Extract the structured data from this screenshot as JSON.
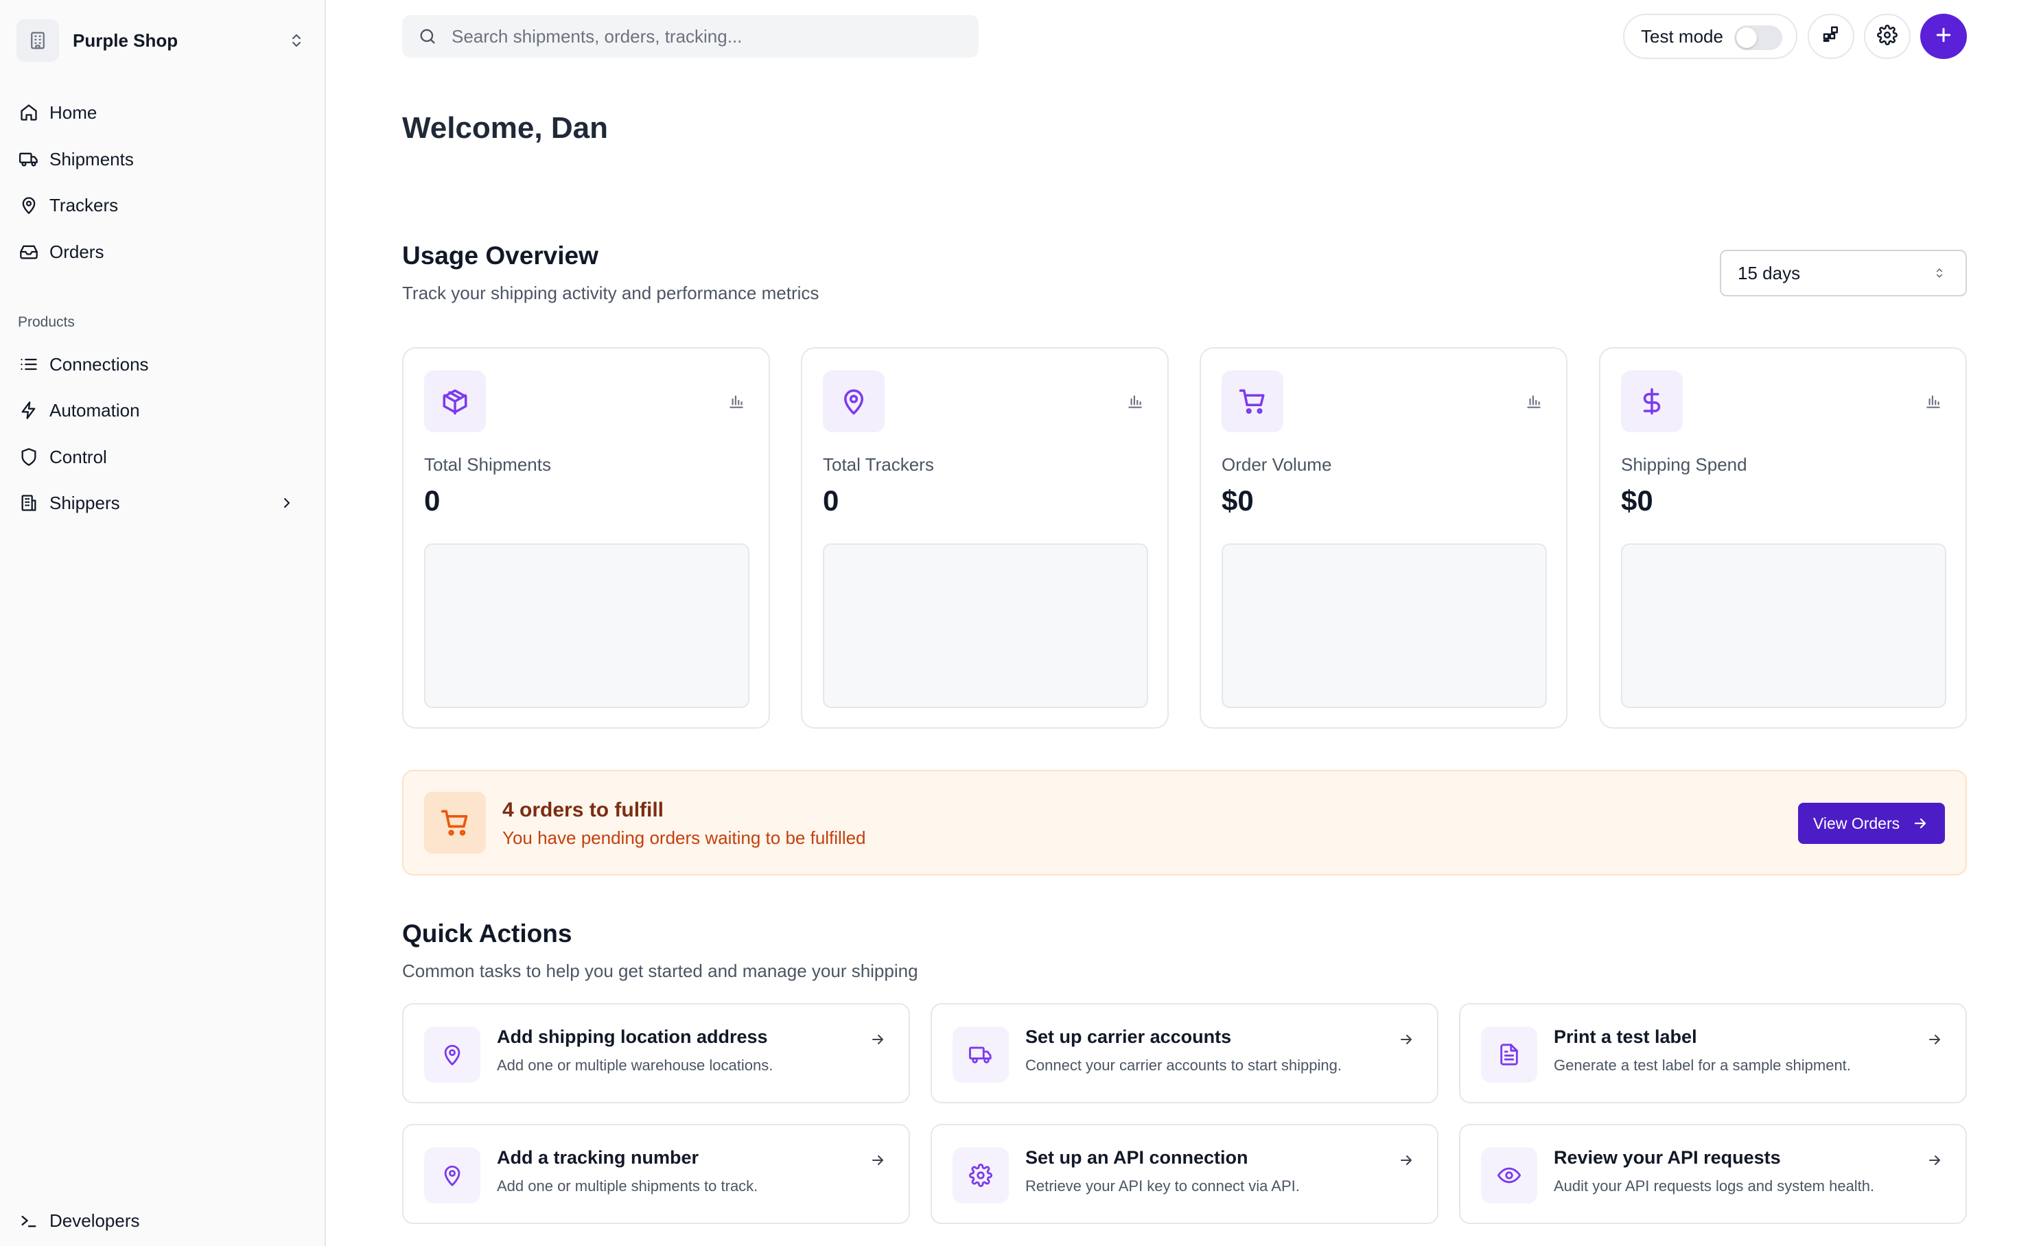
{
  "sidebar": {
    "org_name": "Purple Shop",
    "nav": [
      {
        "label": "Home",
        "icon": "home-icon"
      },
      {
        "label": "Shipments",
        "icon": "truck-icon"
      },
      {
        "label": "Trackers",
        "icon": "map-pin-icon"
      },
      {
        "label": "Orders",
        "icon": "inbox-icon"
      }
    ],
    "products_heading": "Products",
    "products": [
      {
        "label": "Connections",
        "icon": "list-icon"
      },
      {
        "label": "Automation",
        "icon": "bolt-icon"
      },
      {
        "label": "Control",
        "icon": "shield-icon"
      },
      {
        "label": "Shippers",
        "icon": "building-icon"
      }
    ],
    "developers_label": "Developers"
  },
  "topbar": {
    "search_placeholder": "Search shipments, orders, tracking...",
    "test_mode_label": "Test mode",
    "test_mode_on": false
  },
  "main": {
    "welcome": "Welcome, Dan",
    "usage": {
      "title": "Usage Overview",
      "subtitle": "Track your shipping activity and performance metrics",
      "period": "15 days",
      "stats": [
        {
          "label": "Total Shipments",
          "value": "0",
          "icon": "package-icon"
        },
        {
          "label": "Total Trackers",
          "value": "0",
          "icon": "map-pin-icon"
        },
        {
          "label": "Order Volume",
          "value": "$0",
          "icon": "cart-icon"
        },
        {
          "label": "Shipping Spend",
          "value": "$0",
          "icon": "dollar-icon"
        }
      ]
    },
    "banner": {
      "title": "4 orders to fulfill",
      "subtitle": "You have pending orders waiting to be fulfilled",
      "button": "View Orders"
    },
    "quick_actions": {
      "title": "Quick Actions",
      "subtitle": "Common tasks to help you get started and manage your shipping",
      "items": [
        {
          "title": "Add shipping location address",
          "desc": "Add one or multiple warehouse locations.",
          "icon": "map-pin-icon"
        },
        {
          "title": "Set up carrier accounts",
          "desc": "Connect your carrier accounts to start shipping.",
          "icon": "truck-icon"
        },
        {
          "title": "Print a test label",
          "desc": "Generate a test label for a sample shipment.",
          "icon": "file-text-icon"
        },
        {
          "title": "Add a tracking number",
          "desc": "Add one or multiple shipments to track.",
          "icon": "map-pin-icon"
        },
        {
          "title": "Set up an API connection",
          "desc": "Retrieve your API key to connect via API.",
          "icon": "gear-icon"
        },
        {
          "title": "Review your API requests",
          "desc": "Audit your API requests logs and system health.",
          "icon": "eye-icon"
        }
      ]
    }
  },
  "colors": {
    "accent": "#5b21d8",
    "accent_soft": "#f3effd",
    "banner_bg": "#fff6ed",
    "banner_title": "#7c2d12",
    "banner_text": "#c2410c"
  }
}
